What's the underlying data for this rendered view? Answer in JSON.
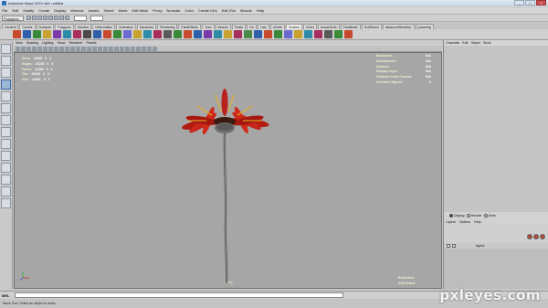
{
  "window": {
    "title": "Autodesk Maya 2013 x64: untitled"
  },
  "menubar": {
    "items": [
      "File",
      "Edit",
      "Modify",
      "Create",
      "Display",
      "Window",
      "Assets",
      "Select",
      "Mesh",
      "Edit Mesh",
      "Proxy",
      "Normals",
      "Color",
      "Create UVs",
      "Edit UVs",
      "Muscle",
      "Help"
    ]
  },
  "statusline": {
    "menuset": "Polygons"
  },
  "shelf": {
    "tabs": [
      "General",
      "Curves",
      "Surfaces",
      "Polygons",
      "Subdivs",
      "Deformation",
      "Animation",
      "Dynamics",
      "Rendering",
      "PaintEffects",
      "Toon",
      "Muscle",
      "Fluids",
      "Fur",
      "Hair",
      "nCloth",
      "Custom",
      "XGen",
      "bonusTools",
      "PaulNeale",
      "GoZBrush",
      "advancedSkeleton",
      "powering"
    ],
    "active_tab": "Custom",
    "icon_colors": [
      "#c84a2e",
      "#2e5fa8",
      "#3a8a3a",
      "#c8a22e",
      "#7a3aa8",
      "#2e8ca8",
      "#a82e5f",
      "#4a4a4a",
      "#2e5fa8",
      "#c84a2e",
      "#3a8a3a",
      "#6a6ad0",
      "#c8a22e",
      "#2e8ca8",
      "#a82e5f",
      "#5a5a5a",
      "#3a8a3a",
      "#c84a2e",
      "#2e5fa8",
      "#7a3aa8",
      "#2e8ca8",
      "#c8a22e",
      "#a82e5f",
      "#4a8a4a",
      "#2e5fa8",
      "#c84a2e",
      "#3a8a3a",
      "#6a6ad0",
      "#c8a22e",
      "#2e8ca8",
      "#a82e5f",
      "#5a5a5a",
      "#3a8a3a",
      "#c84a2e"
    ]
  },
  "panel": {
    "menus": [
      "View",
      "Shading",
      "Lighting",
      "Show",
      "Renderer",
      "Panels"
    ]
  },
  "hud_left": [
    {
      "label": "Verts:",
      "values": [
        "11580",
        "0",
        "0"
      ]
    },
    {
      "label": "Edges:",
      "values": [
        "23248",
        "0",
        "0"
      ]
    },
    {
      "label": "Faces:",
      "values": [
        "11596",
        "0",
        "0"
      ]
    },
    {
      "label": "Tris:",
      "values": [
        "22416",
        "0",
        "0"
      ]
    },
    {
      "label": "UVs:",
      "values": [
        "12621",
        "0",
        "0"
      ]
    }
  ],
  "hud_right": [
    {
      "label": "Backfaces:",
      "value": "N/A"
    },
    {
      "label": "Smoothness:",
      "value": "N/A"
    },
    {
      "label": "Instance:",
      "value": "N/A"
    },
    {
      "label": "Display Layer:",
      "value": "N/A"
    },
    {
      "label": "Distance From Camera:",
      "value": "N/A"
    },
    {
      "label": "Selected Objects:",
      "value": "0"
    }
  ],
  "hud_bottom": [
    {
      "label": "Reflection:",
      "value": "Off"
    },
    {
      "label": "Soft Select:",
      "value": "Off"
    }
  ],
  "viewport": {
    "camera": "persp"
  },
  "channelbox": {
    "tabs": [
      "Channels",
      "Edit",
      "Object",
      "Show"
    ]
  },
  "layers": {
    "modes": [
      "Display",
      "Render",
      "Anim"
    ],
    "active_mode": "Display",
    "menu": [
      "Layers",
      "Options",
      "Help"
    ],
    "items": [
      {
        "name": "layer1"
      }
    ]
  },
  "commandline": {
    "label": "MEL"
  },
  "helpline": {
    "text": "Move Tool: Select an object to move."
  },
  "watermark": {
    "text": "pxleyes.com"
  }
}
